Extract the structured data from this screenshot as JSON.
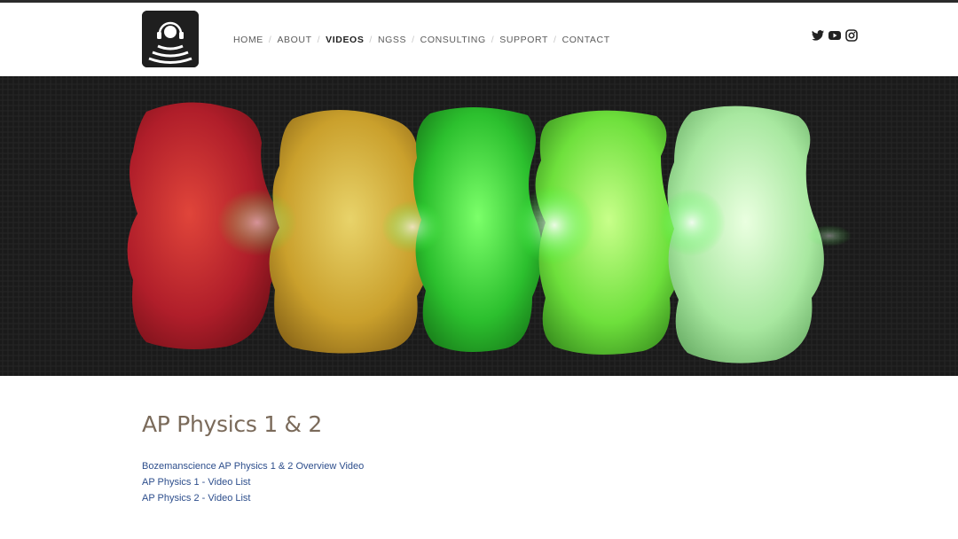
{
  "nav": {
    "items": [
      {
        "label": "HOME",
        "active": false
      },
      {
        "label": "ABOUT",
        "active": false
      },
      {
        "label": "VIDEOS",
        "active": true
      },
      {
        "label": "NGSS",
        "active": false
      },
      {
        "label": "CONSULTING",
        "active": false
      },
      {
        "label": "SUPPORT",
        "active": false
      },
      {
        "label": "CONTACT",
        "active": false
      }
    ],
    "separator": "/"
  },
  "social": {
    "icons": [
      "twitter-icon",
      "youtube-icon",
      "instagram-icon"
    ]
  },
  "hero": {
    "image": "gummy-bears-laser-image",
    "bear_colors": [
      "#c8202a",
      "#d9b43a",
      "#38d13c",
      "#7ee84a",
      "#bfeebb"
    ]
  },
  "content": {
    "title": "AP Physics 1 & 2",
    "links": [
      "Bozemanscience AP Physics 1 & 2 Overview Video",
      "AP Physics 1 - Video List",
      "AP Physics 2 - Video List"
    ]
  },
  "colors": {
    "title": "#7a6a5a",
    "link": "#2d4e8c",
    "nav_text": "#5a5a5a",
    "nav_active": "#222222"
  }
}
